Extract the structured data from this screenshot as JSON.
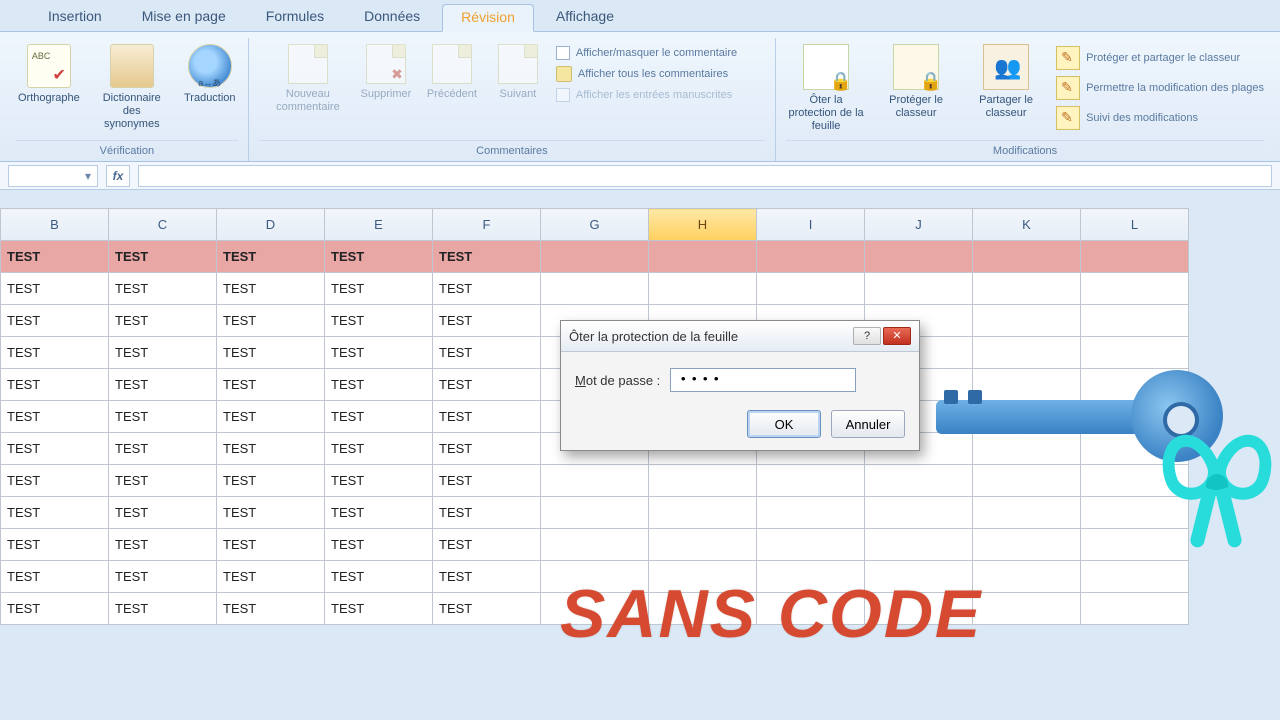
{
  "tabs": {
    "items": [
      "Insertion",
      "Mise en page",
      "Formules",
      "Données",
      "Révision",
      "Affichage"
    ],
    "active_index": 4
  },
  "ribbon": {
    "verification": {
      "label": "Vérification",
      "spelling": "Orthographe",
      "thesaurus": "Dictionnaire des synonymes",
      "translate": "Traduction"
    },
    "comments": {
      "label": "Commentaires",
      "new": "Nouveau commentaire",
      "delete": "Supprimer",
      "prev": "Précédent",
      "next": "Suivant",
      "opt_show_hide": "Afficher/masquer le commentaire",
      "opt_show_all": "Afficher tous les commentaires",
      "opt_show_ink": "Afficher les entrées manuscrites"
    },
    "changes": {
      "label": "Modifications",
      "unprotect_sheet": "Ôter la protection de la feuille",
      "protect_wb": "Protéger le classeur",
      "share_wb": "Partager le classeur",
      "protect_share": "Protéger et partager le classeur",
      "allow_ranges": "Permettre la modification des plages",
      "track": "Suivi des modifications"
    }
  },
  "formula_bar": {
    "name_box": "",
    "formula": ""
  },
  "grid": {
    "columns": [
      "B",
      "C",
      "D",
      "E",
      "F",
      "G",
      "H",
      "I",
      "J",
      "K",
      "L"
    ],
    "selected_column_index": 6,
    "header_row_value": "TEST",
    "cell_value": "TEST",
    "filled_cols": 5,
    "data_rows": 11
  },
  "dialog": {
    "title": "Ôter la protection de la feuille",
    "pwd_label_underline": "M",
    "pwd_label_rest": "ot de passe :",
    "pwd_value": "••••",
    "ok": "OK",
    "cancel": "Annuler",
    "help_hint": "?"
  },
  "overlay": {
    "text": "SANS CODE"
  }
}
